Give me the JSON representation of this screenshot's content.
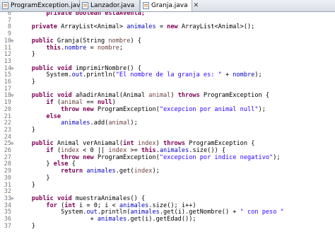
{
  "tabs": [
    {
      "label": "ProgramException.java",
      "active": false
    },
    {
      "label": "Lanzador.java",
      "active": false
    },
    {
      "label": "Granja.java",
      "active": true
    }
  ],
  "close_glyph": "✕",
  "colors": {
    "keyword": "#7f0055",
    "field": "#0000c0",
    "string": "#2a00ff",
    "parameter": "#6a3e3e",
    "line_number": "#7a7a7a"
  },
  "lines": [
    {
      "n": "6",
      "fold": "",
      "segs": [
        [
          "        ",
          ""
        ],
        [
          "private boolean estaAventa;",
          "kw"
        ]
      ]
    },
    {
      "n": "7",
      "fold": "",
      "segs": []
    },
    {
      "n": "8",
      "fold": "",
      "segs": [
        [
          "    ",
          ""
        ],
        [
          "private",
          "kw"
        ],
        [
          " ArrayList<Animal> ",
          ""
        ],
        [
          "animales",
          "fld"
        ],
        [
          " = ",
          ""
        ],
        [
          "new",
          "kw"
        ],
        [
          " ArrayList<Animal>();",
          ""
        ]
      ]
    },
    {
      "n": "9",
      "fold": "",
      "segs": []
    },
    {
      "n": "10",
      "fold": "⊖",
      "segs": [
        [
          "    ",
          ""
        ],
        [
          "public",
          "kw"
        ],
        [
          " Granja(String ",
          ""
        ],
        [
          "nombre",
          "prm"
        ],
        [
          ") {",
          ""
        ]
      ]
    },
    {
      "n": "11",
      "fold": "",
      "segs": [
        [
          "        ",
          ""
        ],
        [
          "this",
          "kw"
        ],
        [
          ".",
          ""
        ],
        [
          "nombre",
          "fld"
        ],
        [
          " = ",
          ""
        ],
        [
          "nombre",
          "prm"
        ],
        [
          ";",
          ""
        ]
      ]
    },
    {
      "n": "12",
      "fold": "",
      "segs": [
        [
          "    }",
          ""
        ]
      ]
    },
    {
      "n": "13",
      "fold": "",
      "segs": []
    },
    {
      "n": "14",
      "fold": "⊖",
      "segs": [
        [
          "    ",
          ""
        ],
        [
          "public",
          "kw"
        ],
        [
          " ",
          ""
        ],
        [
          "void",
          "kw"
        ],
        [
          " imprimirNombre() {",
          ""
        ]
      ]
    },
    {
      "n": "15",
      "fold": "",
      "segs": [
        [
          "        System.",
          ""
        ],
        [
          "out",
          "fld"
        ],
        [
          ".println(",
          ""
        ],
        [
          "\"El nombre de la granja es: \"",
          "str"
        ],
        [
          " + ",
          ""
        ],
        [
          "nombre",
          "fld"
        ],
        [
          ");",
          ""
        ]
      ]
    },
    {
      "n": "16",
      "fold": "",
      "segs": [
        [
          "    }",
          ""
        ]
      ]
    },
    {
      "n": "17",
      "fold": "",
      "segs": []
    },
    {
      "n": "18",
      "fold": "⊖",
      "segs": [
        [
          "    ",
          ""
        ],
        [
          "public",
          "kw"
        ],
        [
          " ",
          ""
        ],
        [
          "void",
          "kw"
        ],
        [
          " añadirAnimal(Animal ",
          ""
        ],
        [
          "animal",
          "prm"
        ],
        [
          ") ",
          ""
        ],
        [
          "throws",
          "kw"
        ],
        [
          " ProgramException {",
          ""
        ]
      ]
    },
    {
      "n": "19",
      "fold": "",
      "segs": [
        [
          "        ",
          ""
        ],
        [
          "if",
          "kw"
        ],
        [
          " (",
          ""
        ],
        [
          "animal",
          "prm"
        ],
        [
          " == ",
          ""
        ],
        [
          "null",
          "kw"
        ],
        [
          ")",
          ""
        ]
      ]
    },
    {
      "n": "20",
      "fold": "",
      "segs": [
        [
          "            ",
          ""
        ],
        [
          "throw",
          "kw"
        ],
        [
          " ",
          ""
        ],
        [
          "new",
          "kw"
        ],
        [
          " ProgramException(",
          ""
        ],
        [
          "\"excepcion por animal null\"",
          "str"
        ],
        [
          ");",
          ""
        ]
      ]
    },
    {
      "n": "21",
      "fold": "",
      "segs": [
        [
          "        ",
          ""
        ],
        [
          "else",
          "kw"
        ]
      ]
    },
    {
      "n": "22",
      "fold": "",
      "segs": [
        [
          "            ",
          ""
        ],
        [
          "animales",
          "fld"
        ],
        [
          ".add(",
          ""
        ],
        [
          "animal",
          "prm"
        ],
        [
          ");",
          ""
        ]
      ]
    },
    {
      "n": "23",
      "fold": "",
      "segs": [
        [
          "    }",
          ""
        ]
      ]
    },
    {
      "n": "24",
      "fold": "",
      "segs": []
    },
    {
      "n": "25",
      "fold": "⊖",
      "segs": [
        [
          "    ",
          ""
        ],
        [
          "public",
          "kw"
        ],
        [
          " Animal verAniamal(",
          ""
        ],
        [
          "int",
          "kw"
        ],
        [
          " ",
          ""
        ],
        [
          "index",
          "prm"
        ],
        [
          ") ",
          ""
        ],
        [
          "throws",
          "kw"
        ],
        [
          " ProgramException {",
          ""
        ]
      ]
    },
    {
      "n": "26",
      "fold": "",
      "segs": [
        [
          "        ",
          ""
        ],
        [
          "if",
          "kw"
        ],
        [
          " (",
          ""
        ],
        [
          "index",
          "prm"
        ],
        [
          " < 0 || ",
          ""
        ],
        [
          "index",
          "prm"
        ],
        [
          " >= ",
          ""
        ],
        [
          "this",
          "kw"
        ],
        [
          ".",
          ""
        ],
        [
          "animales",
          "fld"
        ],
        [
          ".size()) {",
          ""
        ]
      ]
    },
    {
      "n": "27",
      "fold": "",
      "segs": [
        [
          "            ",
          ""
        ],
        [
          "throw",
          "kw"
        ],
        [
          " ",
          ""
        ],
        [
          "new",
          "kw"
        ],
        [
          " ProgramException(",
          ""
        ],
        [
          "\"excepcion por indice negativo\"",
          "str"
        ],
        [
          ");",
          ""
        ]
      ]
    },
    {
      "n": "28",
      "fold": "",
      "segs": [
        [
          "        } ",
          ""
        ],
        [
          "else",
          "kw"
        ],
        [
          " {",
          ""
        ]
      ]
    },
    {
      "n": "29",
      "fold": "",
      "segs": [
        [
          "            ",
          ""
        ],
        [
          "return",
          "kw"
        ],
        [
          " ",
          ""
        ],
        [
          "animales",
          "fld"
        ],
        [
          ".get(",
          ""
        ],
        [
          "index",
          "prm"
        ],
        [
          ");",
          ""
        ]
      ]
    },
    {
      "n": "30",
      "fold": "",
      "segs": [
        [
          "        }",
          ""
        ]
      ]
    },
    {
      "n": "31",
      "fold": "",
      "segs": [
        [
          "    }",
          ""
        ]
      ]
    },
    {
      "n": "32",
      "fold": "",
      "segs": []
    },
    {
      "n": "33",
      "fold": "⊖",
      "segs": [
        [
          "    ",
          ""
        ],
        [
          "public",
          "kw"
        ],
        [
          " ",
          ""
        ],
        [
          "void",
          "kw"
        ],
        [
          " muestraAnimales() {",
          ""
        ]
      ]
    },
    {
      "n": "34",
      "fold": "",
      "segs": [
        [
          "        ",
          ""
        ],
        [
          "for",
          "kw"
        ],
        [
          " (",
          ""
        ],
        [
          "int",
          "kw"
        ],
        [
          " i = 0; i < ",
          ""
        ],
        [
          "animales",
          "fld"
        ],
        [
          ".size(); i++)",
          ""
        ]
      ]
    },
    {
      "n": "35",
      "fold": "",
      "segs": [
        [
          "            System.",
          ""
        ],
        [
          "out",
          "fld"
        ],
        [
          ".println(",
          ""
        ],
        [
          "animales",
          "fld"
        ],
        [
          ".get(i).getNombre() + ",
          ""
        ],
        [
          "\" con peso \"",
          "str"
        ]
      ]
    },
    {
      "n": "36",
      "fold": "",
      "segs": [
        [
          "                    + ",
          ""
        ],
        [
          "animales",
          "fld"
        ],
        [
          ".get(i).getEdad());",
          ""
        ]
      ]
    },
    {
      "n": "37",
      "fold": "",
      "segs": [
        [
          "    }",
          ""
        ]
      ]
    }
  ]
}
